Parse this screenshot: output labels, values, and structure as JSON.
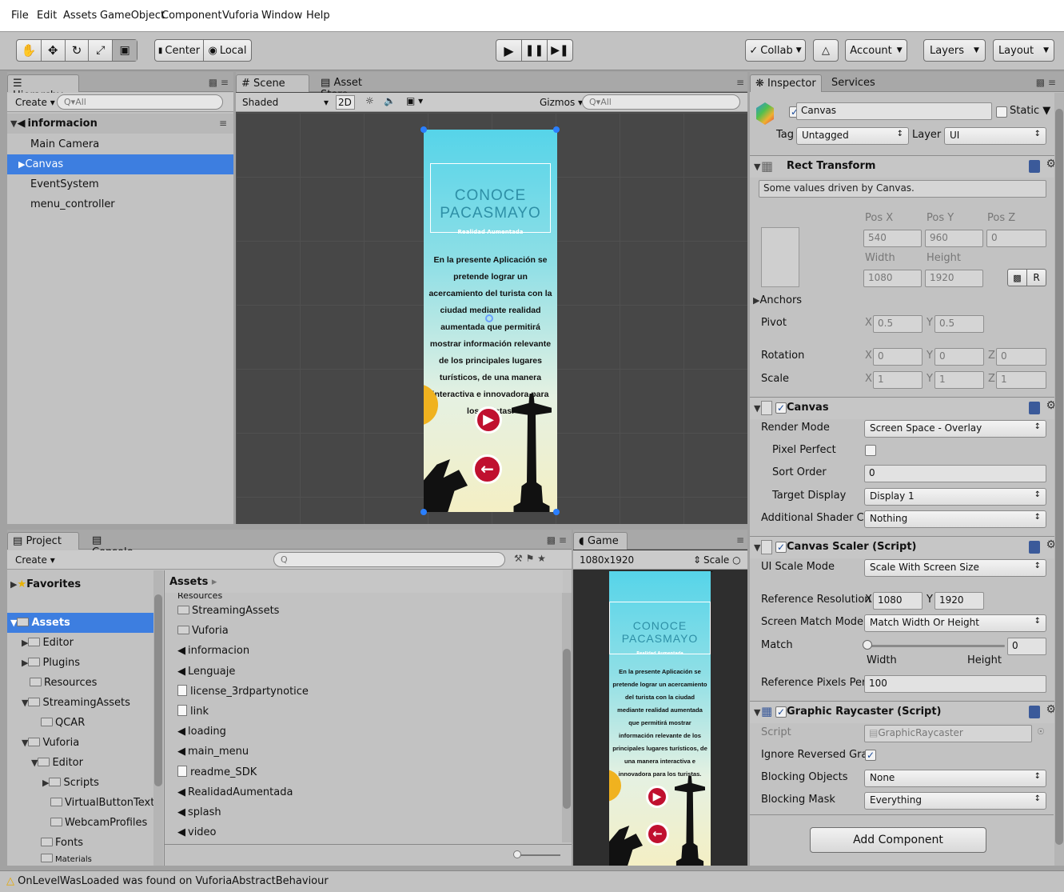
{
  "menu": [
    "File",
    "Edit",
    "Assets",
    "GameObject",
    "Component",
    "Vuforia",
    "Window",
    "Help"
  ],
  "toolbar": {
    "center_label": "Center",
    "local_label": "Local",
    "collab_label": "Collab",
    "account_label": "Account",
    "layers_label": "Layers",
    "layout_label": "Layout"
  },
  "hierarchy": {
    "tab": "Hierarchy",
    "create": "Create",
    "search_placeholder": "All",
    "scene": "informacion",
    "items": [
      "Main Camera",
      "Canvas",
      "EventSystem",
      "menu_controller"
    ],
    "selected": "Canvas"
  },
  "scene": {
    "tab_scene": "Scene",
    "tab_asset_store": "Asset Store",
    "shading": "Shaded",
    "mode_2d": "2D",
    "gizmos": "Gizmos",
    "search_placeholder": "All"
  },
  "phone": {
    "title": "CONOCE PACASMAYO",
    "subtitle": "Realidad Aumentada",
    "body": "En la presente Aplicación se pretende lograr un acercamiento del turista con la ciudad mediante realidad aumentada que permitirá mostrar información relevante de los principales lugares turísticos, de una manera interactiva e innovadora para los turistas."
  },
  "project": {
    "tab_project": "Project",
    "tab_console": "Console",
    "create": "Create",
    "favorites": "Favorites",
    "assets_root": "Assets",
    "tree": [
      "Editor",
      "Plugins",
      "Resources",
      "StreamingAssets",
      "QCAR",
      "Vuforia",
      "Editor",
      "Scripts",
      "VirtualButtonTextur",
      "WebcamProfiles",
      "Fonts",
      "Materials"
    ],
    "breadcrumb": "Assets",
    "list_partial_top": "Resources",
    "list": [
      {
        "name": "StreamingAssets",
        "kind": "folder"
      },
      {
        "name": "Vuforia",
        "kind": "folder"
      },
      {
        "name": "informacion",
        "kind": "scene"
      },
      {
        "name": "Lenguaje",
        "kind": "scene"
      },
      {
        "name": "license_3rdpartynotice",
        "kind": "doc"
      },
      {
        "name": "link",
        "kind": "doc"
      },
      {
        "name": "loading",
        "kind": "scene"
      },
      {
        "name": "main_menu",
        "kind": "scene"
      },
      {
        "name": "readme_SDK",
        "kind": "doc"
      },
      {
        "name": "RealidadAumentada",
        "kind": "scene"
      },
      {
        "name": "splash",
        "kind": "scene"
      },
      {
        "name": "video",
        "kind": "scene"
      }
    ]
  },
  "game": {
    "tab": "Game",
    "resolution": "1080x1920",
    "scale": "Scale"
  },
  "inspector": {
    "tab_inspector": "Inspector",
    "tab_services": "Services",
    "object_name": "Canvas",
    "static_label": "Static",
    "tag_label": "Tag",
    "tag_value": "Untagged",
    "layer_label": "Layer",
    "layer_value": "UI",
    "rect_transform": {
      "title": "Rect Transform",
      "note": "Some values driven by Canvas.",
      "pos_x_label": "Pos X",
      "pos_y_label": "Pos Y",
      "pos_z_label": "Pos Z",
      "pos_x": "540",
      "pos_y": "960",
      "pos_z": "0",
      "width_label": "Width",
      "height_label": "Height",
      "width": "1080",
      "height": "1920",
      "r_button": "R",
      "anchors": "Anchors",
      "pivot_label": "Pivot",
      "pivot_x": "0.5",
      "pivot_y": "0.5",
      "rotation_label": "Rotation",
      "rot_x": "0",
      "rot_y": "0",
      "rot_z": "0",
      "scale_label": "Scale",
      "scale_x": "1",
      "scale_y": "1",
      "scale_z": "1",
      "x": "X",
      "y": "Y",
      "z": "Z"
    },
    "canvas": {
      "title": "Canvas",
      "render_mode_label": "Render Mode",
      "render_mode": "Screen Space - Overlay",
      "pixel_perfect_label": "Pixel Perfect",
      "sort_order_label": "Sort Order",
      "sort_order": "0",
      "target_display_label": "Target Display",
      "target_display": "Display 1",
      "shader_label": "Additional Shader Char",
      "shader_value": "Nothing"
    },
    "scaler": {
      "title": "Canvas Scaler (Script)",
      "ui_scale_mode_label": "UI Scale Mode",
      "ui_scale_mode": "Scale With Screen Size",
      "ref_res_label": "Reference Resolution",
      "ref_x": "1080",
      "ref_y": "1920",
      "match_mode_label": "Screen Match Mode",
      "match_mode": "Match Width Or Height",
      "match_label": "Match",
      "match_value": "0",
      "match_fraction": 0,
      "width_label": "Width",
      "height_label": "Height",
      "ref_ppu_label": "Reference Pixels Per Ur",
      "ref_ppu": "100"
    },
    "raycaster": {
      "title": "Graphic Raycaster (Script)",
      "script_label": "Script",
      "script_value": "GraphicRaycaster",
      "ignore_label": "Ignore Reversed Graph",
      "blocking_objects_label": "Blocking Objects",
      "blocking_objects": "None",
      "blocking_mask_label": "Blocking Mask",
      "blocking_mask": "Everything"
    },
    "add_component": "Add Component"
  },
  "status": "OnLevelWasLoaded was found on VuforiaAbstractBehaviour"
}
